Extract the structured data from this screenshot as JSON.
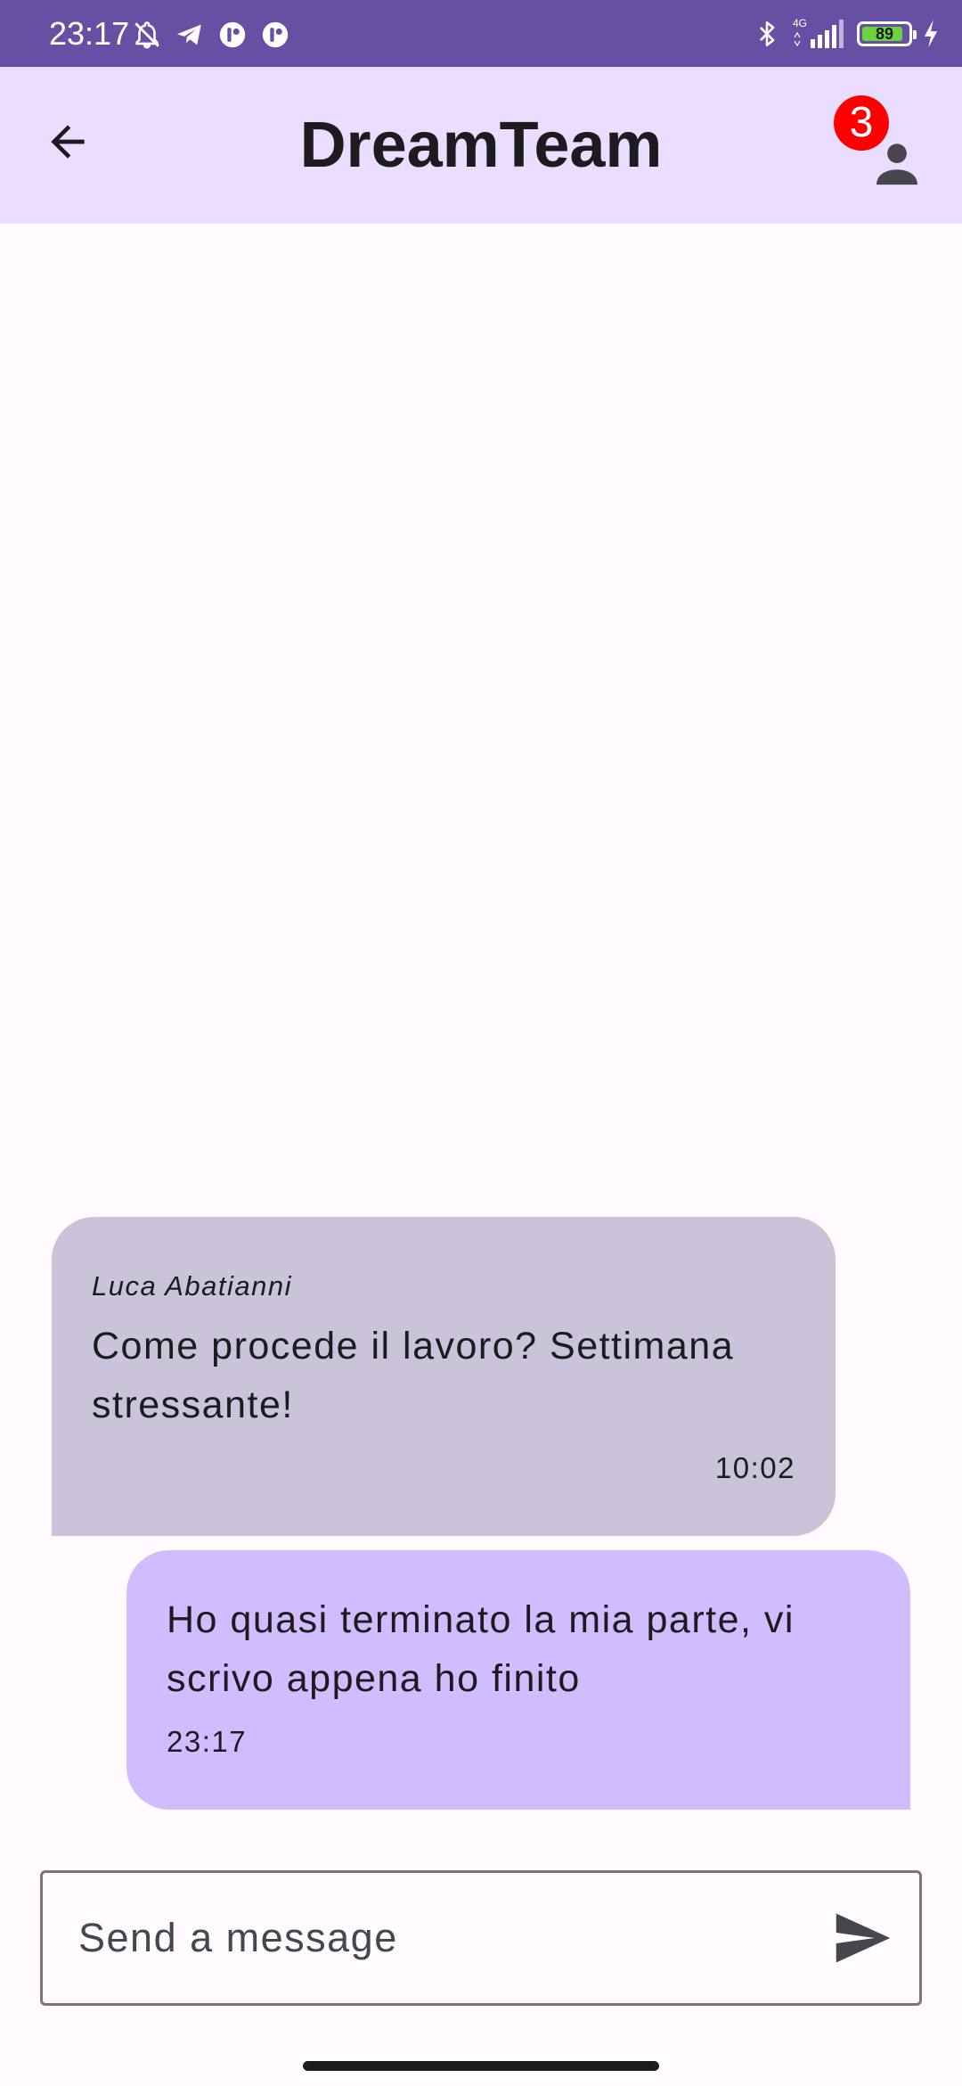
{
  "status_bar": {
    "time": "23:17",
    "network_label": "4G",
    "battery_level": "89",
    "battery_fraction": 0.89,
    "battery_color": "#6bd43d",
    "background": "#6750a4"
  },
  "app_bar": {
    "title": "DreamTeam",
    "background": "#eaddff",
    "back_icon": "arrow-back-icon",
    "members_icon": "person-icon",
    "members_badge": "3",
    "badge_color": "#ff0000"
  },
  "messages": [
    {
      "direction": "received",
      "sender": "Luca Abatianni",
      "text": "Come procede il lavoro? Settimana stressante!",
      "time": "10:02",
      "bubble_color": "#cbc3da"
    },
    {
      "direction": "sent",
      "text": "Ho quasi terminato la mia parte, vi scrivo appena ho finito",
      "time": "23:17",
      "bubble_color": "#d0bcff"
    }
  ],
  "composer": {
    "placeholder": "Send a message",
    "value": "",
    "send_icon": "send-icon"
  }
}
